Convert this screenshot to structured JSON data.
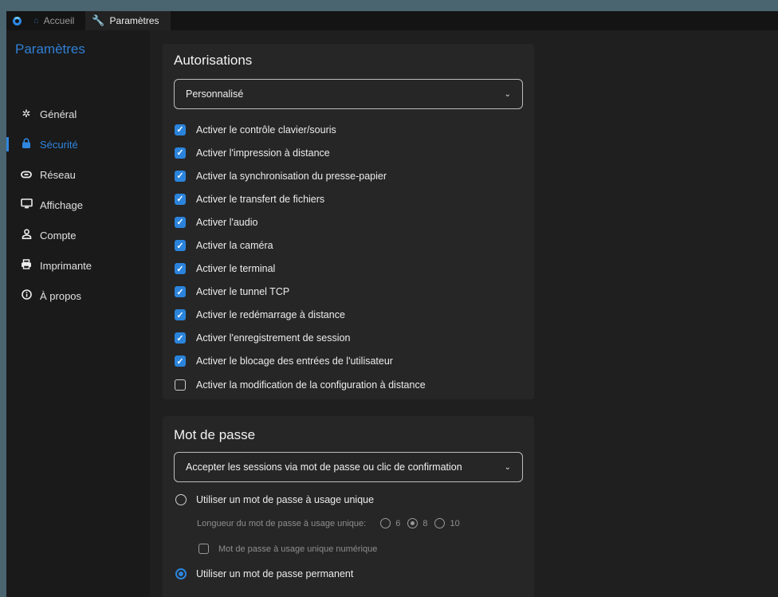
{
  "tabs": [
    {
      "label": "Accueil",
      "icon": "home-icon"
    },
    {
      "label": "Paramètres",
      "icon": "wrench-icon"
    }
  ],
  "sidebar": {
    "title": "Paramètres",
    "items": [
      {
        "label": "Général",
        "icon": "gear-icon",
        "glyph": "✲"
      },
      {
        "label": "Sécurité",
        "icon": "lock-icon",
        "glyph": "🔒"
      },
      {
        "label": "Réseau",
        "icon": "link-icon",
        "glyph": "⊖"
      },
      {
        "label": "Affichage",
        "icon": "monitor-icon",
        "glyph": "▭"
      },
      {
        "label": "Compte",
        "icon": "person-icon",
        "glyph": "♙"
      },
      {
        "label": "Imprimante",
        "icon": "printer-icon",
        "glyph": "⎙"
      },
      {
        "label": "À propos",
        "icon": "info-icon",
        "glyph": "ⓘ"
      }
    ],
    "active_index": 1
  },
  "permissions": {
    "title": "Autorisations",
    "select_value": "Personnalisé",
    "options": [
      {
        "label": "Activer le contrôle clavier/souris",
        "checked": true
      },
      {
        "label": "Activer l'impression à distance",
        "checked": true
      },
      {
        "label": "Activer la synchronisation du presse-papier",
        "checked": true
      },
      {
        "label": "Activer le transfert de fichiers",
        "checked": true
      },
      {
        "label": "Activer l'audio",
        "checked": true
      },
      {
        "label": "Activer la caméra",
        "checked": true
      },
      {
        "label": "Activer le terminal",
        "checked": true
      },
      {
        "label": "Activer le tunnel TCP",
        "checked": true
      },
      {
        "label": "Activer le redémarrage à distance",
        "checked": true
      },
      {
        "label": "Activer l'enregistrement de session",
        "checked": true
      },
      {
        "label": "Activer le blocage des entrées de l'utilisateur",
        "checked": true
      },
      {
        "label": "Activer la modification de la configuration à distance",
        "checked": false
      }
    ]
  },
  "password": {
    "title": "Mot de passe",
    "select_value": "Accepter les sessions via mot de passe ou clic de confirmation",
    "one_time_label": "Utiliser un mot de passe à usage unique",
    "one_time_selected": false,
    "length_label": "Longueur du mot de passe à usage unique:",
    "lengths": [
      "6",
      "8",
      "10"
    ],
    "length_selected": "8",
    "numeric_label": "Mot de passe à usage unique numérique",
    "numeric_checked": false,
    "permanent_label": "Utiliser un mot de passe permanent",
    "permanent_selected": true
  },
  "colors": {
    "accent": "#2b84dc",
    "window_bg": "#1f1f1f",
    "card_bg": "#262626"
  }
}
